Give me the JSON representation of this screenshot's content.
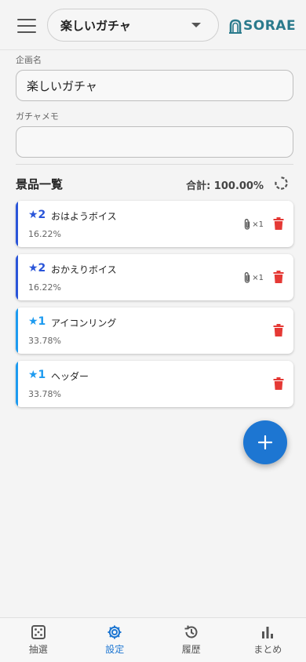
{
  "header": {
    "gacha_selected": "楽しいガチャ",
    "logo_text": "SORAE",
    "icons": {
      "menu": "hamburger-menu-icon",
      "caret": "caret-down-icon",
      "logo": "sorae-logo-icon"
    }
  },
  "form": {
    "name_label": "企画名",
    "name_value": "楽しいガチャ",
    "memo_label": "ガチャメモ",
    "memo_value": ""
  },
  "prizes": {
    "title": "景品一覧",
    "total_label": "合計: 100.00%",
    "items": [
      {
        "rarity": "★2",
        "name": "おはようボイス",
        "pct": "16.22%",
        "attach": "×1",
        "color": "#2a55d9"
      },
      {
        "rarity": "★2",
        "name": "おかえりボイス",
        "pct": "16.22%",
        "attach": "×1",
        "color": "#2a55d9"
      },
      {
        "rarity": "★1",
        "name": "アイコンリング",
        "pct": "33.78%",
        "attach": "",
        "color": "#1d9bf0"
      },
      {
        "rarity": "★1",
        "name": "ヘッダー",
        "pct": "33.78%",
        "attach": "",
        "color": "#1d9bf0"
      }
    ]
  },
  "colors": {
    "accent": "#1d76d2",
    "delete": "#e53935",
    "rarity2": "#2a55d9",
    "rarity1": "#1d9bf0"
  },
  "nav": {
    "items": [
      {
        "label": "抽選",
        "icon": "dice-icon"
      },
      {
        "label": "設定",
        "icon": "gear-icon"
      },
      {
        "label": "履歴",
        "icon": "history-icon"
      },
      {
        "label": "まとめ",
        "icon": "bar-chart-icon"
      }
    ],
    "active_index": 1
  }
}
